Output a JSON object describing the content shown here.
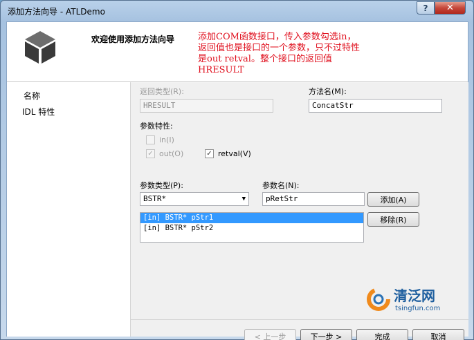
{
  "window": {
    "title": "添加方法向导 - ATLDemo"
  },
  "titlebar": {
    "help_label": "?",
    "close_label": "✕"
  },
  "header": {
    "title": "欢迎使用添加方法向导",
    "annotation": "添加COM函数接口，传入参数勾选in，返回值也是接口的一个参数，只不过特性是out retval。整个接口的返回值HRESULT"
  },
  "nav": {
    "items": [
      {
        "label": "名称"
      },
      {
        "label": "IDL 特性"
      }
    ]
  },
  "form": {
    "return_type_label": "返回类型(R):",
    "return_type_value": "HRESULT",
    "method_name_label": "方法名(M):",
    "method_name_value": "ConcatStr",
    "param_attrs_label": "参数特性:",
    "in_label": "in(I)",
    "out_label": "out(O)",
    "retval_label": "retval(V)",
    "param_type_label": "参数类型(P):",
    "param_type_value": "BSTR*",
    "param_name_label": "参数名(N):",
    "param_name_value": "pRetStr",
    "add_label": "添加(A)",
    "remove_label": "移除(R)",
    "params": [
      "[in] BSTR* pStr1",
      "[in] BSTR* pStr2"
    ]
  },
  "watermark": {
    "brand": "清泛网",
    "url": "tsingfun.com"
  },
  "buttons": {
    "prev": "< 上一步",
    "next": "下一步 >",
    "finish": "完成",
    "cancel": "取消"
  },
  "colors": {
    "annotation": "#e0101e",
    "selection": "#3399ff",
    "logo_orange": "#f08a1c",
    "logo_blue": "#2c73b6"
  }
}
